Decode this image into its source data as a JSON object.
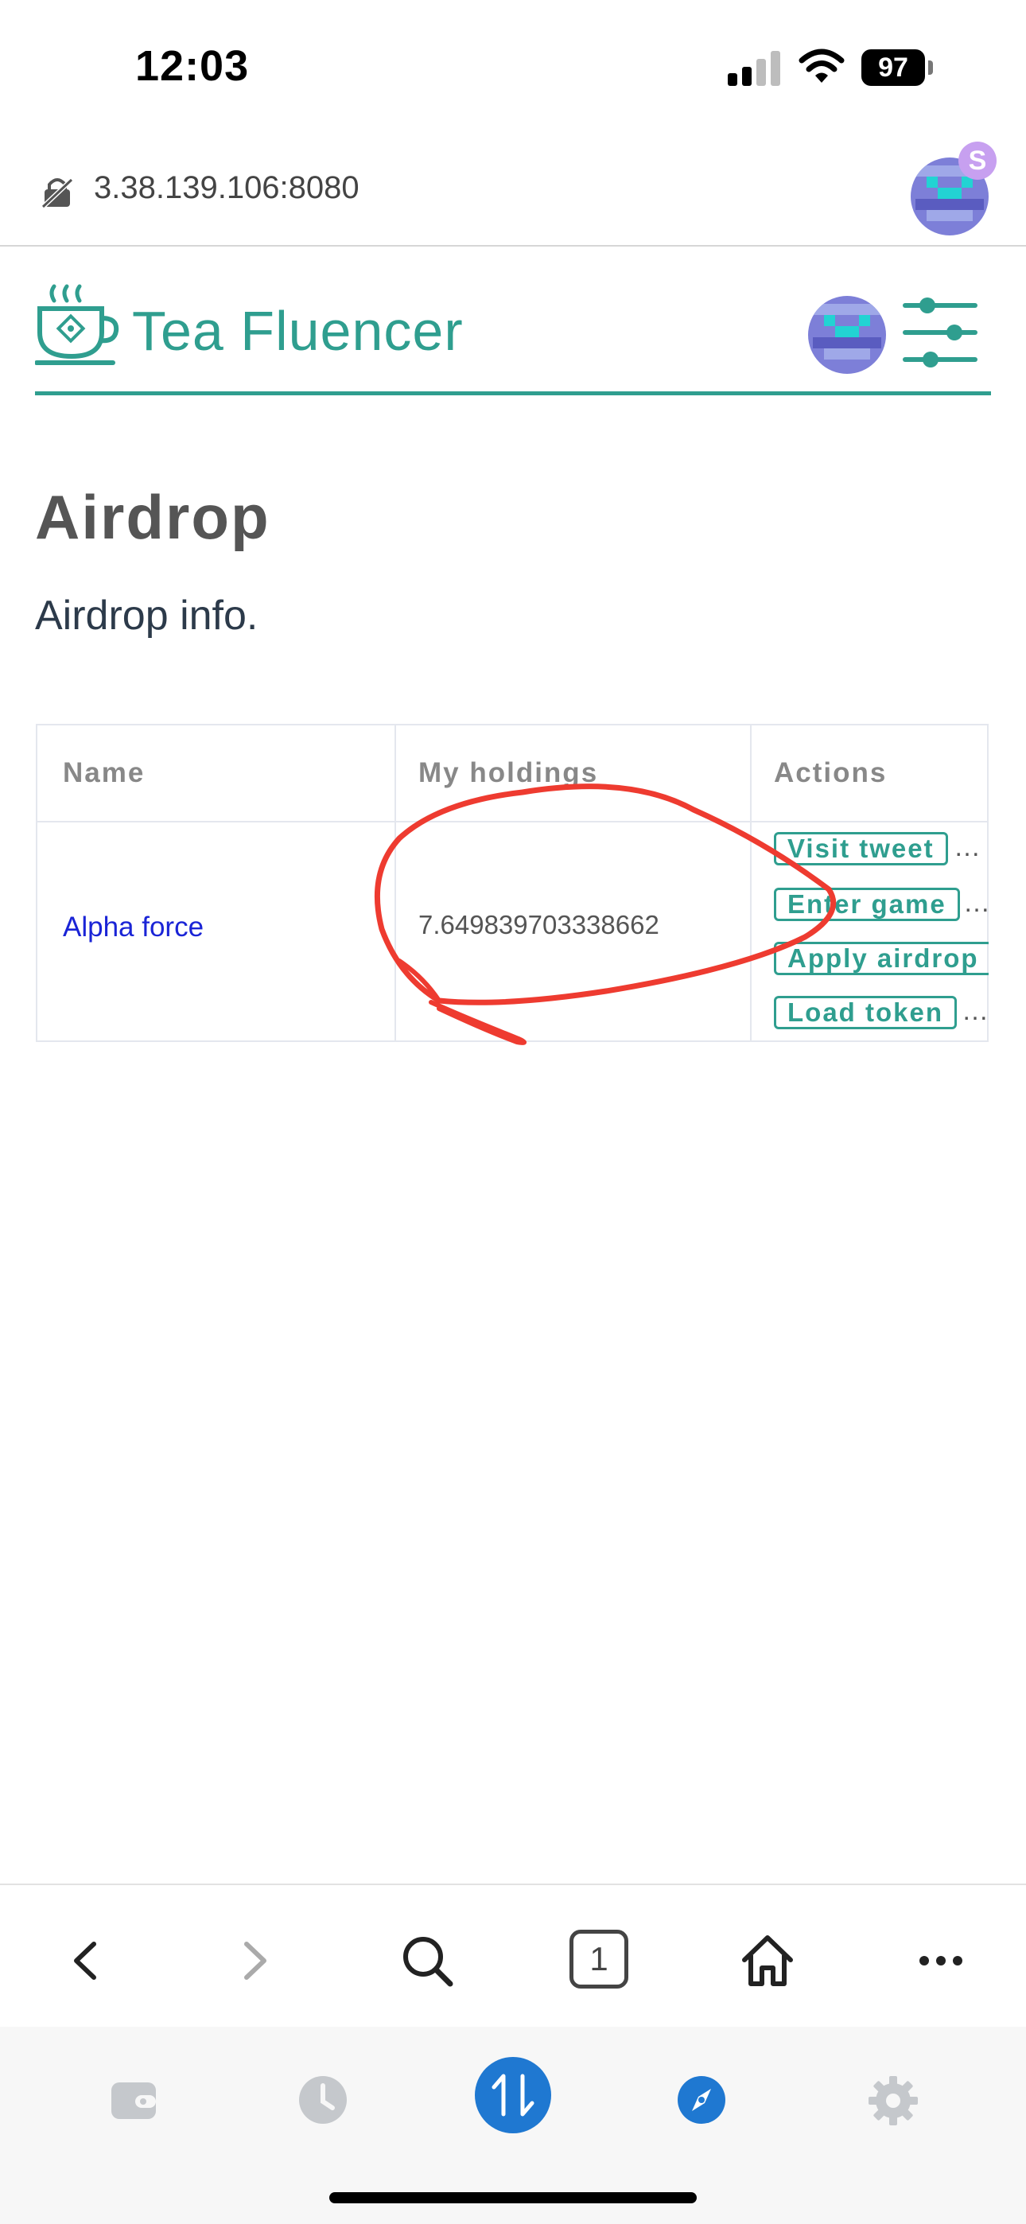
{
  "status_bar": {
    "time": "12:03",
    "battery": "97"
  },
  "browser": {
    "url": "3.38.139.106:8080",
    "profile_badge": "S"
  },
  "site": {
    "brand": "Tea Fluencer",
    "accent": "#2f9e8f"
  },
  "page": {
    "title": "Airdrop",
    "subtitle": "Airdrop info."
  },
  "table": {
    "headers": [
      "Name",
      "My holdings",
      "Actions"
    ],
    "rows": [
      {
        "name": "Alpha force",
        "holdings": "7.649839703338662",
        "actions": [
          "Visit tweet",
          "Enter game",
          "Apply airdrop",
          "Load token"
        ]
      }
    ]
  },
  "annotation": {
    "color": "#ee3b30"
  },
  "browser_toolbar": {
    "tab_count": "1"
  },
  "icons": [
    "lock-slash-icon",
    "tea-cup-icon",
    "sliders-icon",
    "back-icon",
    "forward-icon",
    "search-icon",
    "home-icon",
    "more-icon",
    "wallet-icon",
    "clock-icon",
    "swap-icon",
    "compass-icon",
    "gear-icon"
  ]
}
